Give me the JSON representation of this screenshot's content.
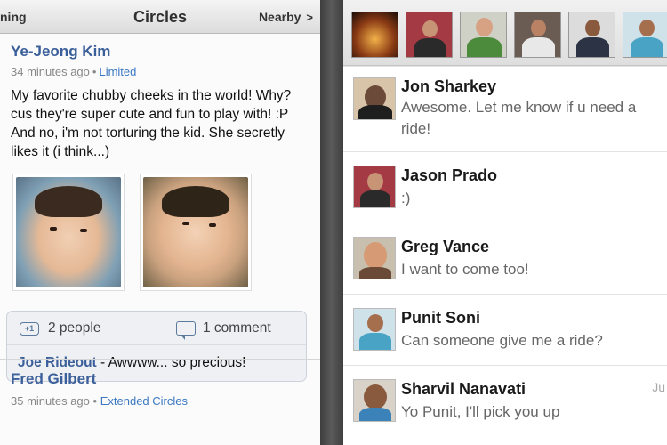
{
  "left": {
    "header": {
      "left_text": "ning",
      "title": "Circles",
      "nearby_label": "Nearby",
      "nearby_chevron": ">"
    },
    "post1": {
      "author": "Ye-Jeong Kim",
      "time": "34 minutes ago",
      "separator": "•",
      "circle": "Limited",
      "text": "My favorite chubby cheeks in the world! Why? cus they're super cute and fun to play with! :P And no, i'm not torturing the kid. She secretly likes it (i think...)",
      "plus_label": "+1",
      "people": "2 people",
      "comments": "1 comment",
      "top_comment_author": "Joe Rideout",
      "top_comment_text": " - Awwww... so precious!"
    },
    "post2": {
      "author": "Fred Gilbert",
      "time": "35 minutes ago",
      "separator": "•",
      "circle": "Extended Circles"
    }
  },
  "right": {
    "messages": [
      {
        "name": "Jon Sharkey",
        "text": "Awesome. Let me know if u need a ride!",
        "time": ""
      },
      {
        "name": "Jason Prado",
        "text": ":)",
        "time": ""
      },
      {
        "name": "Greg Vance",
        "text": "I want to come too!",
        "time": ""
      },
      {
        "name": "Punit Soni",
        "text": "Can someone give me a ride?",
        "time": ""
      },
      {
        "name": "Sharvil Nanavati",
        "text": "Yo Punit, I'll pick you up",
        "time": "Ju"
      }
    ]
  },
  "colors": {
    "link_blue": "#3b5f9a",
    "circle_blue": "#3b78c2",
    "meta_gray": "#888888",
    "message_gray": "#666666"
  },
  "icons": [
    "plus-one-icon",
    "comment-icon",
    "chevron-right-icon"
  ]
}
